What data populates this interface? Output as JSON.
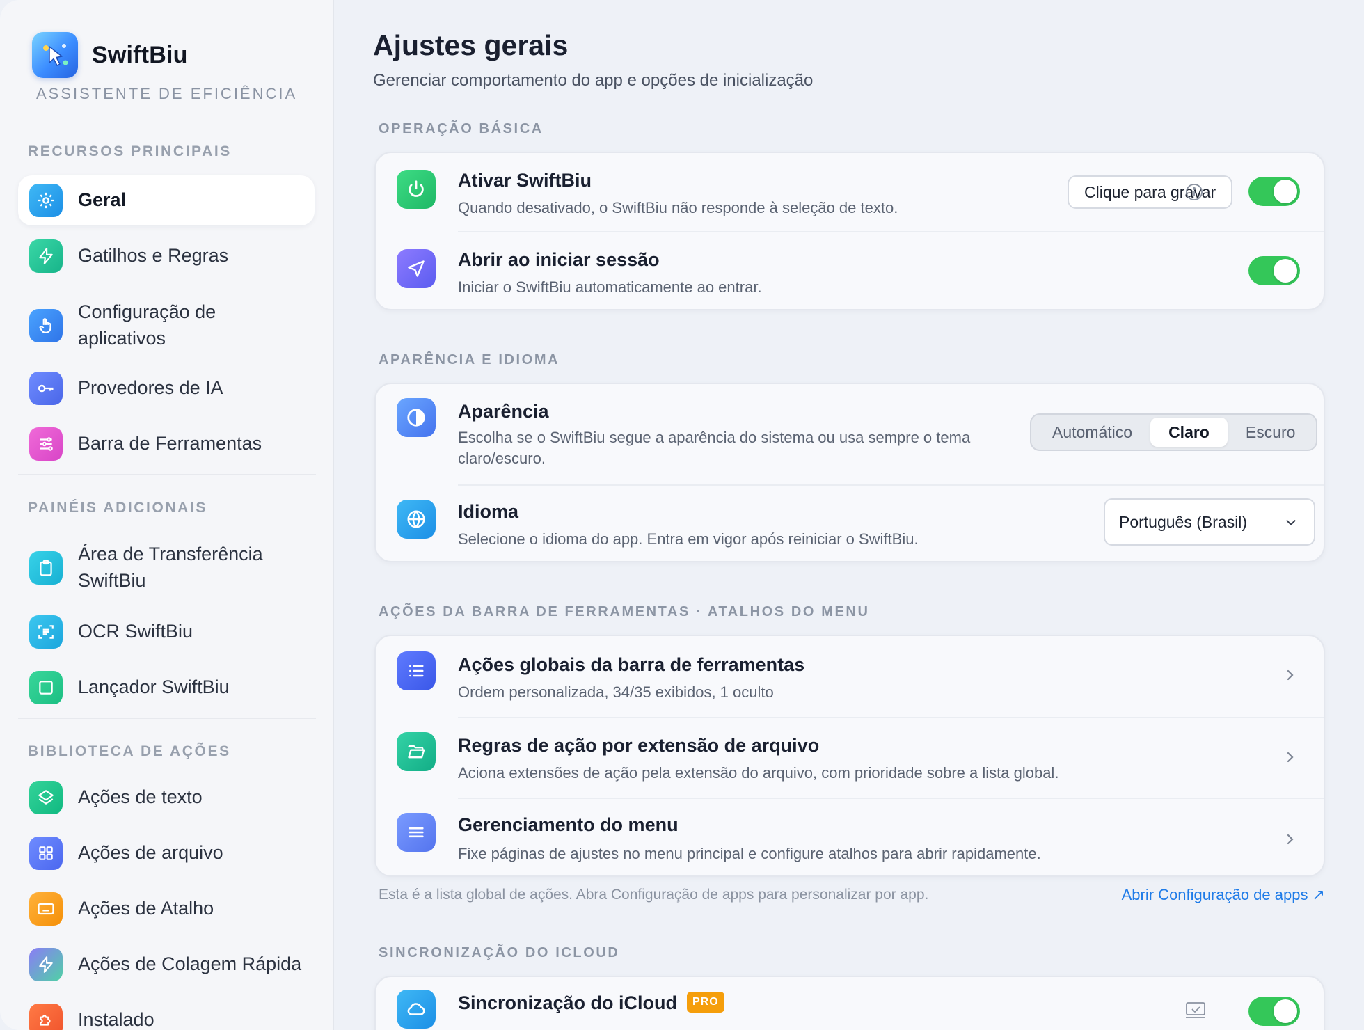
{
  "app": {
    "name": "SwiftBiu",
    "subtitle": "ASSISTENTE DE EFICIÊNCIA"
  },
  "sidebar": {
    "sections": [
      {
        "label": "RECURSOS PRINCIPAIS"
      },
      {
        "label": "PAINÉIS ADICIONAIS"
      },
      {
        "label": "BIBLIOTECA DE AÇÕES"
      }
    ],
    "items": [
      {
        "label": "Geral",
        "icon": "gear-icon",
        "active": true
      },
      {
        "label": "Gatilhos e Regras",
        "icon": "bolt-icon"
      },
      {
        "label": "Configuração de aplicativos",
        "icon": "pointer-hand-icon"
      },
      {
        "label": "Provedores de IA",
        "icon": "key-icon"
      },
      {
        "label": "Barra de Ferramentas",
        "icon": "sliders-icon"
      },
      {
        "label": "Área de Transferência SwiftBiu",
        "icon": "clipboard-icon"
      },
      {
        "label": "OCR SwiftBiu",
        "icon": "scan-text-icon"
      },
      {
        "label": "Lançador SwiftBiu",
        "icon": "launcher-grid-icon"
      },
      {
        "label": "Ações de texto",
        "icon": "layers-icon"
      },
      {
        "label": "Ações de arquivo",
        "icon": "grid-icon"
      },
      {
        "label": "Ações de Atalho",
        "icon": "keyboard-icon"
      },
      {
        "label": "Ações de Colagem Rápida",
        "icon": "bolt-icon"
      },
      {
        "label": "Instalado",
        "icon": "puzzle-icon"
      }
    ]
  },
  "main": {
    "title": "Ajustes gerais",
    "subtitle": "Gerenciar comportamento do app e opções de inicialização",
    "sections": {
      "basic": {
        "label": "OPERAÇÃO BÁSICA",
        "enable": {
          "title": "Ativar SwiftBiu",
          "desc": "Quando desativado, o SwiftBiu não responde à seleção de texto.",
          "record_button": "Clique para gravar",
          "enabled": true
        },
        "login": {
          "title": "Abrir ao iniciar sessão",
          "desc": "Iniciar o SwiftBiu automaticamente ao entrar.",
          "enabled": true
        }
      },
      "appearance": {
        "label": "APARÊNCIA E IDIOMA",
        "theme": {
          "title": "Aparência",
          "desc": "Escolha se o SwiftBiu segue a aparência do sistema ou usa sempre o tema claro/escuro.",
          "options": [
            "Automático",
            "Claro",
            "Escuro"
          ],
          "selected": "Claro"
        },
        "language": {
          "title": "Idioma",
          "desc": "Selecione o idioma do app. Entra em vigor após reiniciar o SwiftBiu.",
          "value": "Português (Brasil)"
        }
      },
      "toolbar": {
        "label": "AÇÕES DA BARRA DE FERRAMENTAS · ATALHOS DO MENU",
        "global": {
          "title": "Ações globais da barra de ferramentas",
          "desc": "Ordem personalizada, 34/35 exibidos, 1 oculto"
        },
        "ext_rules": {
          "title": "Regras de ação por extensão de arquivo",
          "desc": "Aciona extensões de ação pela extensão do arquivo, com prioridade sobre a lista global."
        },
        "menu": {
          "title": "Gerenciamento do menu",
          "desc": "Fixe páginas de ajustes no menu principal e configure atalhos para abrir rapidamente."
        },
        "footnote": "Esta é a lista global de ações. Abra Configuração de apps para personalizar por app.",
        "link": "Abrir Configuração de apps ↗"
      },
      "icloud": {
        "label": "SINCRONIZAÇÃO DO ICLOUD",
        "title": "Sincronização do iCloud",
        "badge": "PRO",
        "enabled": true
      }
    }
  },
  "colors": {
    "accent": "#1e7be8",
    "toggle_on": "#34c759",
    "pro_badge": "#f59e0b"
  }
}
